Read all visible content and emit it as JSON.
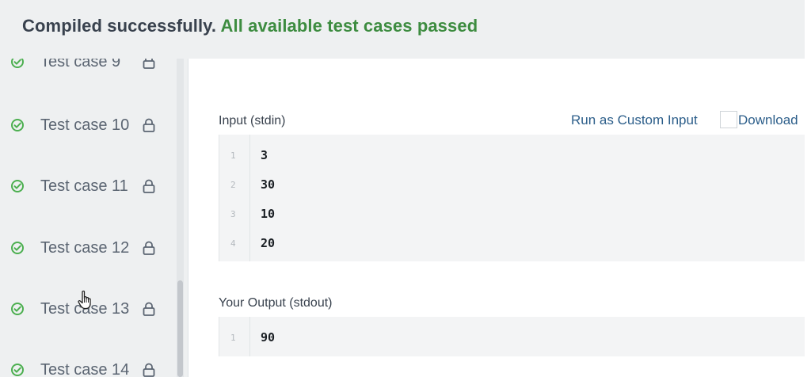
{
  "status": {
    "compiled_text": "Compiled successfully.",
    "passed_text": "All available test cases passed"
  },
  "sidebar": {
    "test_cases": [
      {
        "label": "Test case 9",
        "status": "passed",
        "locked": true
      },
      {
        "label": "Test case 10",
        "status": "passed",
        "locked": true
      },
      {
        "label": "Test case 11",
        "status": "passed",
        "locked": true
      },
      {
        "label": "Test case 12",
        "status": "passed",
        "locked": true
      },
      {
        "label": "Test case 13",
        "status": "passed",
        "locked": true
      },
      {
        "label": "Test case 14",
        "status": "passed",
        "locked": true
      }
    ]
  },
  "input": {
    "label": "Input (stdin)",
    "run_custom_label": "Run as Custom Input",
    "download_label": "Download",
    "lines": [
      {
        "num": "1",
        "text": "3"
      },
      {
        "num": "2",
        "text": "30"
      },
      {
        "num": "3",
        "text": "10"
      },
      {
        "num": "4",
        "text": "20"
      }
    ]
  },
  "output": {
    "label": "Your Output (stdout)",
    "lines": [
      {
        "num": "1",
        "text": "90"
      }
    ]
  },
  "colors": {
    "success_green": "#3d8c40",
    "check_green": "#4caf50",
    "link_blue": "#2c5e8a"
  },
  "icons": {
    "test_status": "check-circle-icon",
    "test_lock": "lock-icon",
    "cursor": "hand-pointer-icon"
  }
}
